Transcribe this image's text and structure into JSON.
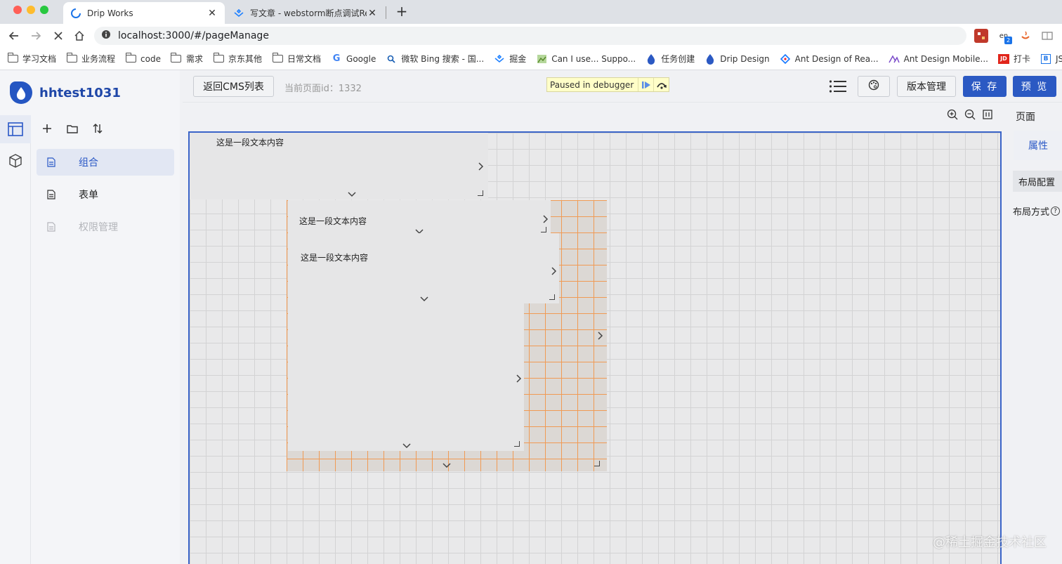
{
  "browser": {
    "tabs": [
      {
        "title": "Drip Works",
        "active": true
      },
      {
        "title": "写文章 - webstorm断点调试Rea",
        "active": false
      }
    ],
    "url": "localhost:3000/#/pageManage",
    "bookmarks": [
      {
        "label": "学习文档",
        "icon": "folder-icon"
      },
      {
        "label": "业务流程",
        "icon": "folder-icon"
      },
      {
        "label": "code",
        "icon": "folder-icon"
      },
      {
        "label": "需求",
        "icon": "folder-icon"
      },
      {
        "label": "京东其他",
        "icon": "folder-icon"
      },
      {
        "label": "日常文档",
        "icon": "folder-icon"
      },
      {
        "label": "Google",
        "icon": "google-icon"
      },
      {
        "label": "微软 Bing 搜索 - 国...",
        "icon": "bing-icon"
      },
      {
        "label": "掘金",
        "icon": "juejin-icon"
      },
      {
        "label": "Can I use... Suppo...",
        "icon": "caniuse-icon"
      },
      {
        "label": "任务创建",
        "icon": "drip-icon"
      },
      {
        "label": "Drip Design",
        "icon": "drip-icon"
      },
      {
        "label": "Ant Design of Rea...",
        "icon": "antd-icon"
      },
      {
        "label": "Ant Design Mobile...",
        "icon": "antd-mobile-icon"
      },
      {
        "label": "打卡",
        "icon": "jd-icon"
      },
      {
        "label": "JS",
        "icon": "js-icon"
      }
    ],
    "extension_badge": "2"
  },
  "app": {
    "brand": "hhtest1031",
    "tree_menu": [
      {
        "label": "组合",
        "state": "selected"
      },
      {
        "label": "表单",
        "state": "normal"
      },
      {
        "label": "权限管理",
        "state": "disabled"
      }
    ],
    "header": {
      "back_button": "返回CMS列表",
      "page_id_text": "当前页面id：1332",
      "version_button": "版本管理",
      "save_button": "保 存",
      "preview_button": "预 览"
    },
    "debugger": {
      "text": "Paused in debugger"
    },
    "right_panel": {
      "title": "页面",
      "tab": "属性",
      "section": "布局配置",
      "layout_label": "布局方式"
    },
    "canvas": {
      "text_blocks": [
        "这是一段文本内容",
        "这是一段文本内容",
        "这是一段文本内容"
      ]
    },
    "accent_color": "#2b59c3",
    "grid_highlight_color": "#f09a54"
  },
  "watermark": "@稀土掘金技术社区"
}
